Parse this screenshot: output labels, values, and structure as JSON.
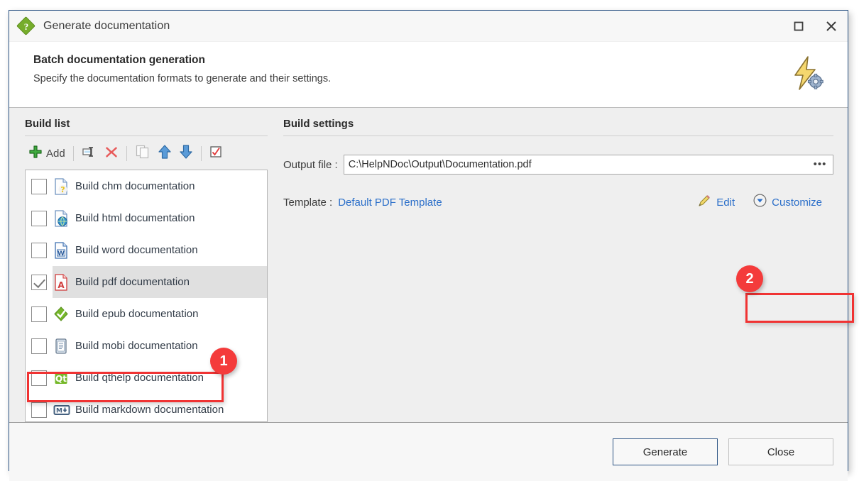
{
  "window": {
    "title": "Generate documentation",
    "title_icon": "helpndoc-diamond-icon",
    "title_icon_glyph": "?",
    "maximize_icon": "maximize-icon",
    "close_icon": "close-icon"
  },
  "header": {
    "title": "Batch documentation generation",
    "subtitle": "Specify the documentation formats to generate and their settings.",
    "icon": "lightning-gear-icon"
  },
  "build_list": {
    "section_title": "Build list",
    "toolbar": [
      {
        "name": "add-button",
        "label": "Add",
        "icon": "plus-icon"
      },
      {
        "name": "rename-button",
        "label": "",
        "icon": "rename-icon"
      },
      {
        "name": "delete-button",
        "label": "",
        "icon": "delete-x-icon"
      },
      {
        "name": "duplicate-button",
        "label": "",
        "icon": "copy-icon"
      },
      {
        "name": "move-up-button",
        "label": "",
        "icon": "arrow-up-icon"
      },
      {
        "name": "move-down-button",
        "label": "",
        "icon": "arrow-down-icon"
      },
      {
        "name": "toggle-all-button",
        "label": "",
        "icon": "checkbox-check-icon"
      }
    ],
    "items": [
      {
        "label": "Build chm documentation",
        "checked": false,
        "selected": false,
        "icon": "chm-file-icon"
      },
      {
        "label": "Build html documentation",
        "checked": false,
        "selected": false,
        "icon": "html-file-icon"
      },
      {
        "label": "Build word documentation",
        "checked": false,
        "selected": false,
        "icon": "word-file-icon"
      },
      {
        "label": "Build pdf documentation",
        "checked": true,
        "selected": true,
        "icon": "pdf-file-icon"
      },
      {
        "label": "Build epub documentation",
        "checked": false,
        "selected": false,
        "icon": "epub-file-icon"
      },
      {
        "label": "Build mobi documentation",
        "checked": false,
        "selected": false,
        "icon": "mobi-file-icon"
      },
      {
        "label": "Build qthelp documentation",
        "checked": false,
        "selected": false,
        "icon": "qthelp-file-icon"
      },
      {
        "label": "Build markdown documentation",
        "checked": false,
        "selected": false,
        "icon": "markdown-file-icon"
      }
    ]
  },
  "build_settings": {
    "section_title": "Build settings",
    "output_file": {
      "label": "Output file :",
      "value": "C:\\HelpNDoc\\Output\\Documentation.pdf",
      "browse_label": "•••",
      "browse_icon": "ellipsis-icon"
    },
    "template": {
      "label": "Template :",
      "value": "Default PDF Template",
      "edit_label": "Edit",
      "edit_icon": "pencil-icon",
      "customize_label": "Customize",
      "customize_icon": "chevron-down-circle-icon"
    }
  },
  "footer": {
    "generate_label": "Generate",
    "close_label": "Close"
  },
  "annotations": [
    {
      "badge": "1",
      "target": "build-pdf-documentation-row"
    },
    {
      "badge": "2",
      "target": "customize-link"
    }
  ],
  "colors": {
    "accent_blue": "#2a6ec9",
    "window_border": "#2c5484",
    "annotation_red": "#f03333",
    "badge_red": "#f43b3b",
    "selection_grey": "#e0e0e0",
    "body_grey": "#efefef"
  }
}
